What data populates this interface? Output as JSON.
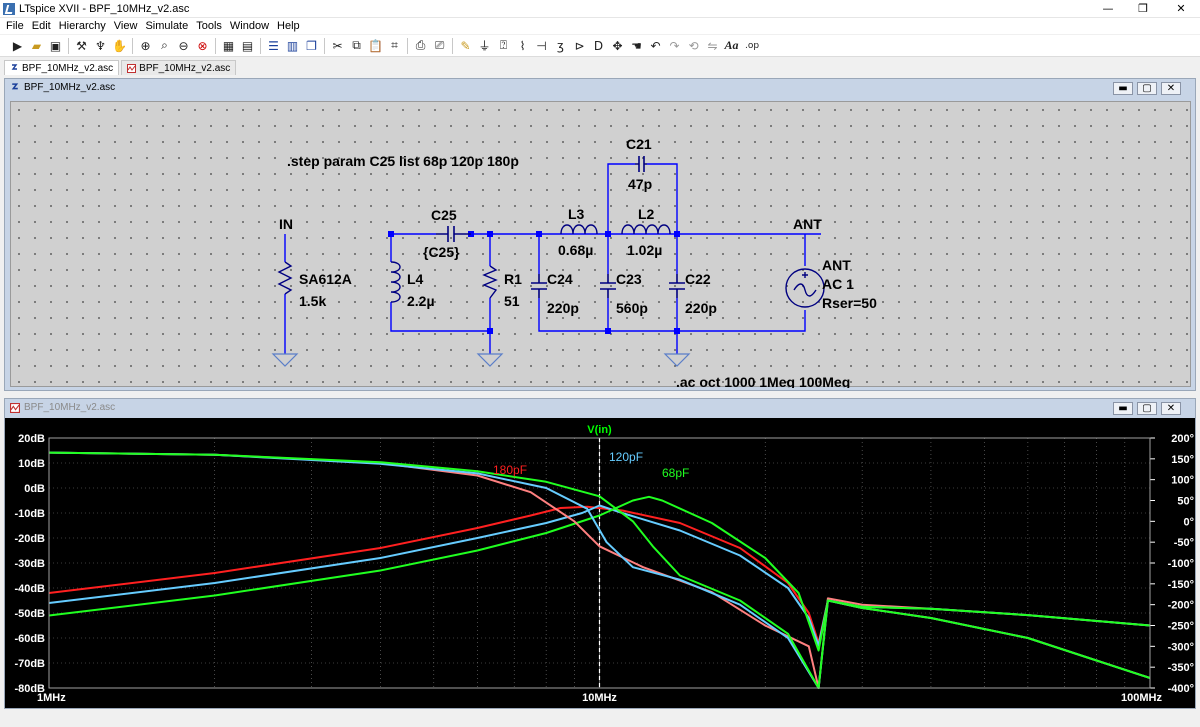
{
  "window": {
    "title": "LTspice XVII - BPF_10MHz_v2.asc",
    "controls": {
      "minimize": "—",
      "restore": "❐",
      "close": "✕"
    }
  },
  "menu": [
    "File",
    "Edit",
    "Hierarchy",
    "View",
    "Simulate",
    "Tools",
    "Window",
    "Help"
  ],
  "toolbar": {
    "icons": [
      "run-icon",
      "open-icon",
      "save-icon",
      "control-panel-icon",
      "run-sim-icon",
      "halt-icon",
      "zoom-in-icon",
      "zoom-area-icon",
      "zoom-out-icon",
      "zoom-cancel-icon",
      "autorange-icon",
      "new-plot-icon",
      "tile-horizontal-icon",
      "tile-vertical-icon",
      "cascade-icon",
      "cut-icon",
      "copy-icon",
      "paste-icon",
      "find-icon",
      "print-icon",
      "print-setup-icon",
      "draw-wire-icon",
      "ground-icon",
      "label-net-icon",
      "resistor-icon",
      "capacitor-icon",
      "inductor-icon",
      "diode-icon",
      "component-icon",
      "move-icon",
      "drag-icon",
      "undo-icon",
      "redo-icon",
      "rotate-icon",
      "mirror-icon"
    ],
    "text_label": "Aa",
    "op_label": ".op"
  },
  "tabs": [
    {
      "label": "BPF_10MHz_v2.asc",
      "kind": "schematic"
    },
    {
      "label": "BPF_10MHz_v2.asc",
      "kind": "waveform"
    }
  ],
  "schematic_window": {
    "title": "BPF_10MHz_v2.asc",
    "directives": {
      "step": ".step param C25 list 68p 120p 180p",
      "ac": ".ac oct 1000 1Meg 100Meg"
    },
    "nets": {
      "in": "IN",
      "ant": "ANT"
    },
    "components": {
      "resistor_src": {
        "name": "SA612A",
        "value": "1.5k"
      },
      "l4": {
        "name": "L4",
        "value": "2.2µ"
      },
      "c25": {
        "name": "C25",
        "value": "{C25}"
      },
      "r1": {
        "name": "R1",
        "value": "51"
      },
      "l3": {
        "name": "L3",
        "value": "0.68µ"
      },
      "l2": {
        "name": "L2",
        "value": "1.02µ"
      },
      "c21": {
        "name": "C21",
        "value": "47p"
      },
      "c24": {
        "name": "C24",
        "value": "220p"
      },
      "c23": {
        "name": "C23",
        "value": "560p"
      },
      "c22": {
        "name": "C22",
        "value": "220p"
      },
      "source": {
        "name": "ANT",
        "value": "AC 1",
        "param": "Rser=50"
      }
    },
    "colors": {
      "wire": "#0000ff",
      "component": "#000080",
      "text": "#000000",
      "ground": "#5a7ec8"
    }
  },
  "plot_window": {
    "title": "BPF_10MHz_v2.asc",
    "trace_label": "V(in)",
    "series_labels": [
      "180pF",
      "120pF",
      "68pF"
    ],
    "colors": {
      "background": "#000000",
      "grid": "#7a7a7a",
      "axis_text": "#ffffff",
      "trace_label": "#00ff00",
      "c180": "#ff2020",
      "c120": "#66ccff",
      "c68": "#20ff20",
      "c180_phase": "#ff8080"
    }
  },
  "chart_data": {
    "type": "line",
    "title": "V(in)",
    "x_scale": "log",
    "xlim": [
      1000000,
      100000000
    ],
    "x_ticks": [
      "1MHz",
      "10MHz",
      "100MHz"
    ],
    "y_left_ticks": [
      "20dB",
      "10dB",
      "0dB",
      "-10dB",
      "-20dB",
      "-30dB",
      "-40dB",
      "-50dB",
      "-60dB",
      "-70dB",
      "-80dB"
    ],
    "ylim_left": [
      -80,
      20
    ],
    "y_right_ticks": [
      "200°",
      "150°",
      "100°",
      "50°",
      "0°",
      "-50°",
      "-100°",
      "-150°",
      "-200°",
      "-250°",
      "-300°",
      "-350°",
      "-400°"
    ],
    "ylim_right": [
      -400,
      200
    ],
    "cursor_x": 10000000,
    "series": [
      {
        "name": "180pF",
        "quantity": "magnitude",
        "x": [
          1000000.0,
          2000000.0,
          4000000.0,
          6000000.0,
          7500000.0,
          8500000.0,
          9500000.0,
          11000000.0,
          14000000.0,
          18000000.0,
          22000000.0,
          24000000.0,
          25000000.0,
          26000000.0,
          30000000.0,
          40000000.0,
          60000000.0,
          100000000.0
        ],
        "y": [
          -42,
          -34,
          -24,
          -16,
          -11,
          -8,
          -7.5,
          -9,
          -14,
          -24,
          -38,
          -50,
          -62,
          -45,
          -48,
          -52,
          -60,
          -76
        ]
      },
      {
        "name": "120pF",
        "quantity": "magnitude",
        "x": [
          1000000.0,
          2000000.0,
          4000000.0,
          6000000.0,
          8000000.0,
          9300000.0,
          10000000.0,
          11000000.0,
          14000000.0,
          18000000.0,
          22000000.0,
          24000000.0,
          25000000.0,
          26000000.0,
          30000000.0,
          40000000.0,
          60000000.0,
          100000000.0
        ],
        "y": [
          -46,
          -38,
          -28,
          -20,
          -14,
          -10,
          -7,
          -10,
          -17,
          -27,
          -40,
          -52,
          -63,
          -45,
          -48,
          -52,
          -60,
          -76
        ]
      },
      {
        "name": "68pF",
        "quantity": "magnitude",
        "x": [
          1000000.0,
          2000000.0,
          4000000.0,
          6000000.0,
          8000000.0,
          10000000.0,
          11500000.0,
          12300000.0,
          13000000.0,
          16000000.0,
          20000000.0,
          23000000.0,
          25000000.0,
          26000000.0,
          30000000.0,
          40000000.0,
          60000000.0,
          100000000.0
        ],
        "y": [
          -51,
          -43,
          -33,
          -25,
          -18,
          -11,
          -5,
          -3.5,
          -5,
          -14,
          -28,
          -42,
          -65,
          -45,
          -48,
          -52,
          -60,
          -76
        ]
      },
      {
        "name": "180pF",
        "quantity": "phase",
        "x": [
          1000000.0,
          2000000.0,
          4000000.0,
          6000000.0,
          7500000.0,
          9000000.0,
          10000000.0,
          12000000.0,
          16000000.0,
          20000000.0,
          24000000.0,
          25000000.0,
          26000000.0,
          30000000.0,
          40000000.0,
          60000000.0,
          100000000.0
        ],
        "y": [
          165,
          160,
          140,
          110,
          70,
          0,
          -60,
          -110,
          -170,
          -250,
          -300,
          -400,
          -185,
          -200,
          -210,
          -225,
          -250
        ]
      },
      {
        "name": "120pF",
        "quantity": "phase",
        "x": [
          1000000.0,
          2000000.0,
          4000000.0,
          6000000.0,
          8000000.0,
          9500000.0,
          10300000.0,
          11500000.0,
          14000000.0,
          18000000.0,
          22000000.0,
          25000000.0,
          26000000.0,
          30000000.0,
          40000000.0,
          60000000.0,
          100000000.0
        ],
        "y": [
          165,
          160,
          138,
          115,
          80,
          30,
          -50,
          -110,
          -140,
          -200,
          -280,
          -400,
          -190,
          -205,
          -210,
          -225,
          -250
        ]
      },
      {
        "name": "68pF",
        "quantity": "phase",
        "x": [
          1000000.0,
          2000000.0,
          4000000.0,
          6000000.0,
          8000000.0,
          10000000.0,
          11500000.0,
          12500000.0,
          14000000.0,
          18000000.0,
          22000000.0,
          25000000.0,
          26000000.0,
          30000000.0,
          40000000.0,
          60000000.0,
          100000000.0
        ],
        "y": [
          165,
          160,
          142,
          120,
          95,
          60,
          0,
          -60,
          -130,
          -190,
          -270,
          -400,
          -190,
          -205,
          -210,
          -225,
          -250
        ]
      }
    ]
  }
}
